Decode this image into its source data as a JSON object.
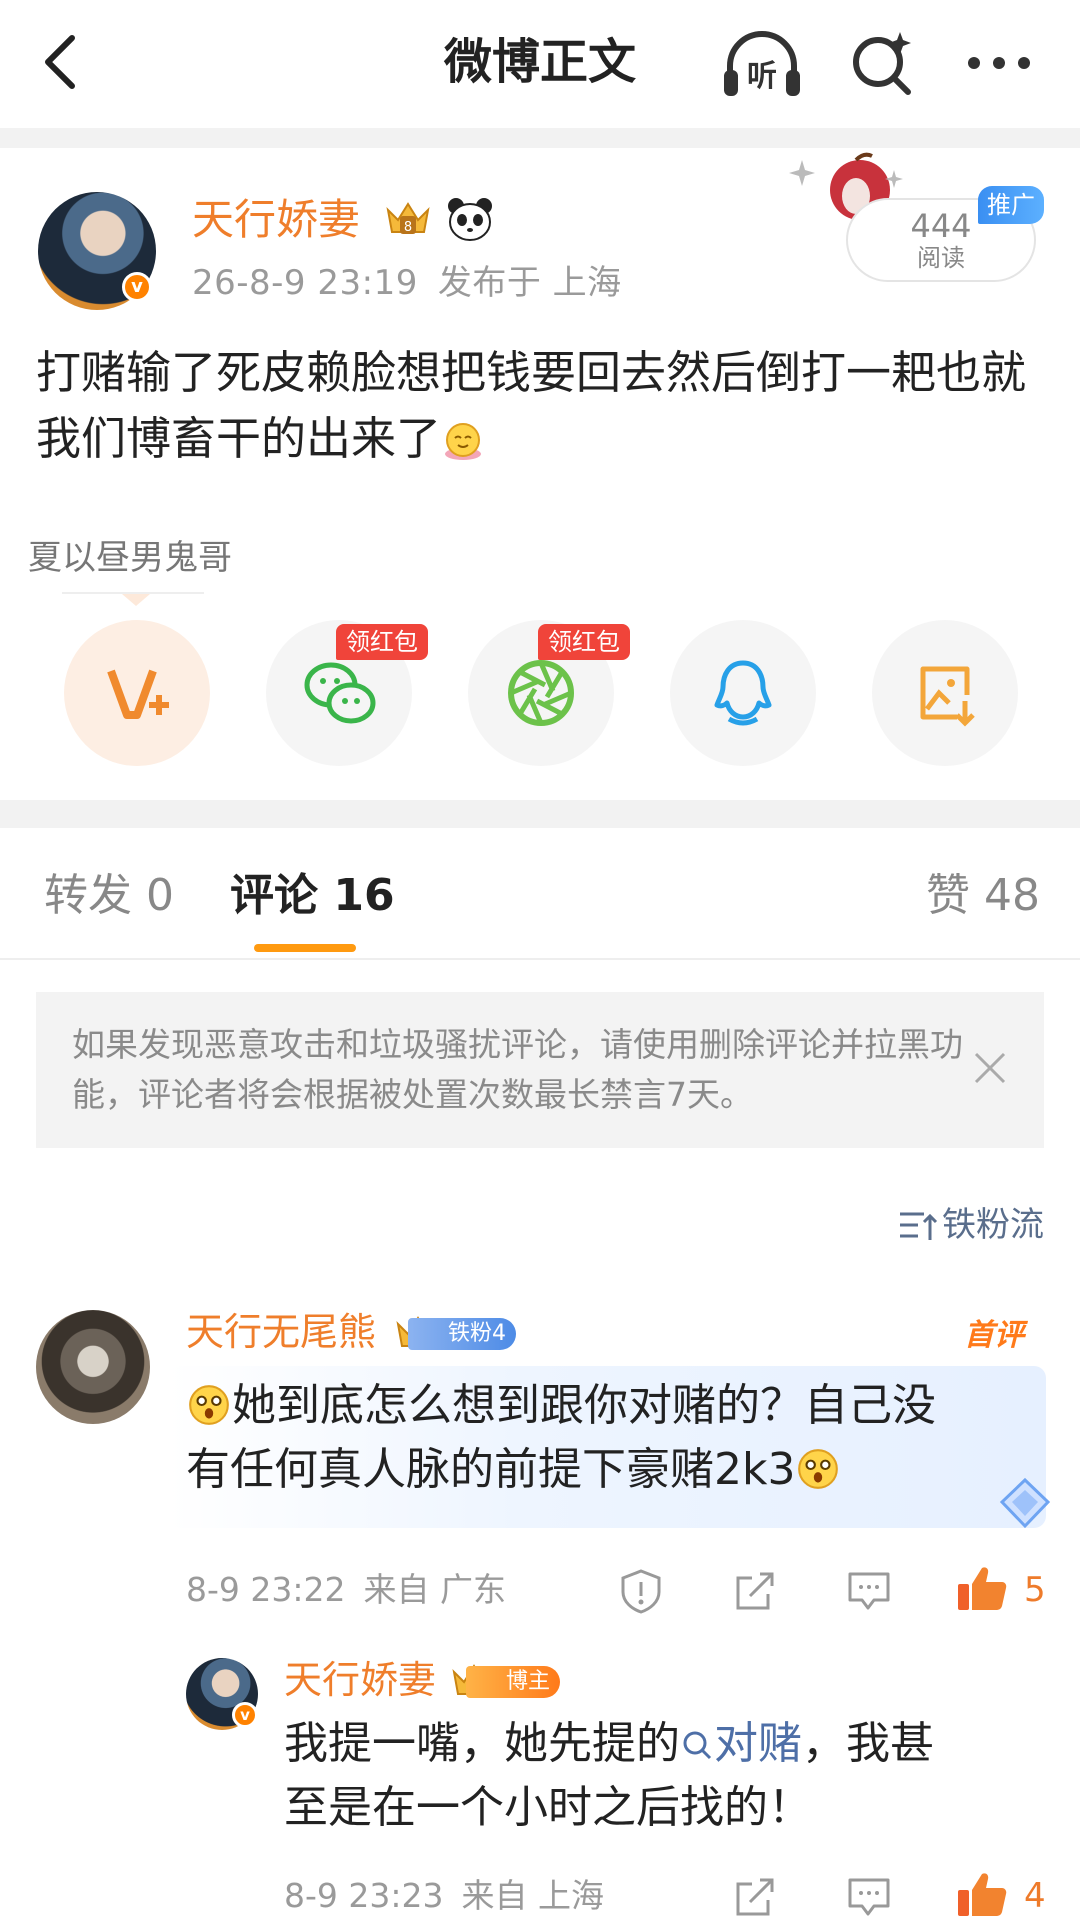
{
  "header": {
    "title": "微博正文"
  },
  "post": {
    "author": "天行娇妻",
    "time": "26-8-9 23:19",
    "location": "发布于 上海",
    "read_count": "444",
    "read_label": "阅读",
    "promo_tag": "推广",
    "text": "打赌输了死皮赖脸想把钱要回去然后倒打一耙也就我们博畜干的出来了",
    "topic": "夏以昼男鬼哥"
  },
  "share": {
    "redpacket_label": "领红包",
    "items": [
      "v-plus",
      "wechat",
      "moments",
      "qq",
      "save-image"
    ]
  },
  "tabs": {
    "repost_label": "转发",
    "repost_count": "0",
    "comment_label": "评论",
    "comment_count": "16",
    "like_label": "赞",
    "like_count": "48"
  },
  "notice": {
    "text": "如果发现恶意攻击和垃圾骚扰评论，请使用删除评论并拉黑功能，评论者将会根据被处置次数最长禁言7天。"
  },
  "sort_label": "铁粉流",
  "comments": [
    {
      "author": "天行无尾熊",
      "badge": "铁粉4",
      "first_tag": "首评",
      "text_line1": "她到底怎么想到跟你对赌的？自己没",
      "text_line2": "有任何真人脉的前提下豪赌2k3",
      "time": "8-9 23:22",
      "location": "来自 广东",
      "likes": "5"
    },
    {
      "author": "天行娇妻",
      "badge": "博主",
      "text_before": "我提一嘴，她先提的",
      "keyword": "对赌",
      "text_after": "，我甚",
      "text_line2": "至是在一个小时之后找的！",
      "time": "8-9 23:23",
      "location": "来自 上海",
      "likes": "4"
    }
  ],
  "colors": {
    "accent": "#ef7e2b",
    "tab_underline": "#ff9a10",
    "keyword": "#4e6fa7",
    "red_tag": "#f0443a"
  }
}
